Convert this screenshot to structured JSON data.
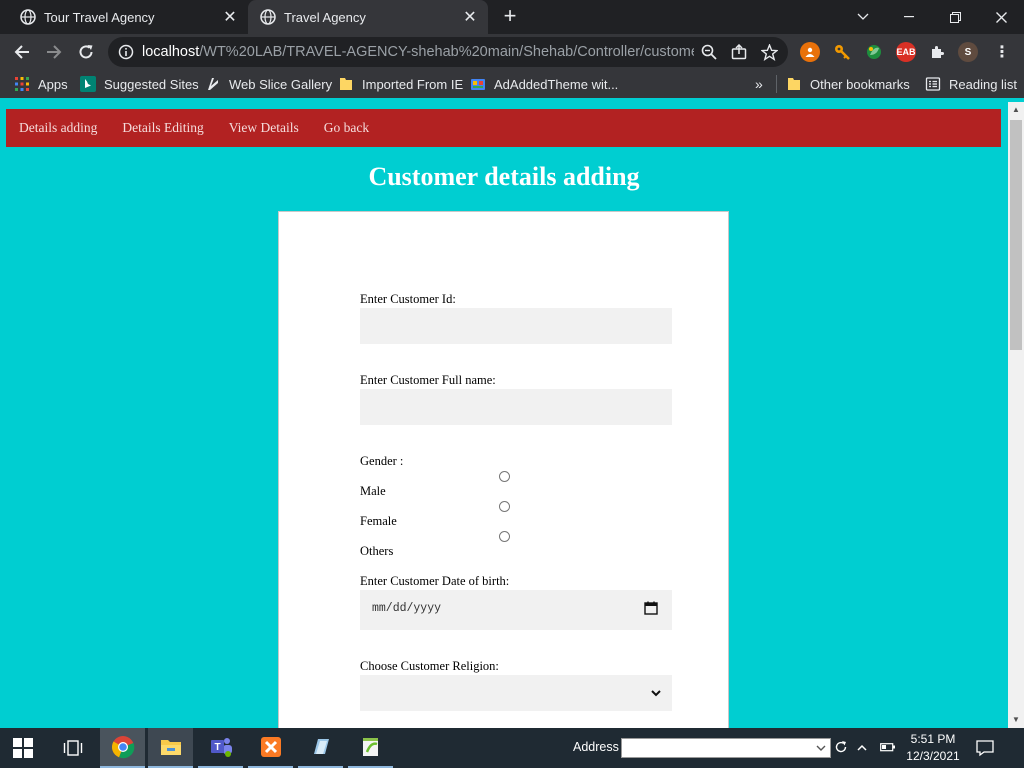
{
  "browser": {
    "tabs": [
      {
        "title": "Tour Travel Agency",
        "active": false
      },
      {
        "title": "Travel Agency",
        "active": true
      }
    ],
    "url_host": "localhost",
    "url_path": "/WT%20LAB/TRAVEL-AGENCY-shehab%20main/Shehab/Controller/customer....",
    "profile_initial": "S",
    "extensions": [
      {
        "name": "orange-person-extension-icon",
        "color": "#e8710a"
      },
      {
        "name": "key-extension-icon",
        "color": "#f29900"
      },
      {
        "name": "green-leaf-extension-icon",
        "color": "#1e8e3e"
      },
      {
        "name": "adblock-extension-icon",
        "color": "#d93025",
        "text": "EAB"
      },
      {
        "name": "puzzle-extensions-icon",
        "color": "#e8eaed"
      }
    ],
    "bookmarks": [
      {
        "label": "Apps",
        "icon": "apps-grid-icon"
      },
      {
        "label": "Suggested Sites",
        "icon": "bing-icon"
      },
      {
        "label": "Web Slice Gallery",
        "icon": "web-slice-icon"
      },
      {
        "label": "Imported From IE",
        "icon": "folder-icon"
      },
      {
        "label": "AdAddedTheme wit...",
        "icon": "theme-icon"
      }
    ],
    "bookmarks_overflow": "»",
    "other_bookmarks": "Other bookmarks",
    "reading_list": "Reading list"
  },
  "page": {
    "bg_color": "#00ced1",
    "nav_color": "#b22222",
    "nav_links": [
      "Details adding",
      "Details Editing",
      "View Details",
      "Go back"
    ],
    "heading": "Customer details adding",
    "form": {
      "id_label": "Enter Customer Id:",
      "id_value": "",
      "name_label": "Enter Customer Full name:",
      "name_value": "",
      "gender_label": "Gender :",
      "gender_options": [
        "Male",
        "Female",
        "Others"
      ],
      "dob_label": "Enter Customer Date of birth:",
      "dob_placeholder": "mm/dd/yyyy",
      "religion_label": "Choose Customer Religion:",
      "religion_value": ""
    }
  },
  "taskbar": {
    "address_label": "Address",
    "time": "5:51 PM",
    "date": "12/3/2021"
  }
}
